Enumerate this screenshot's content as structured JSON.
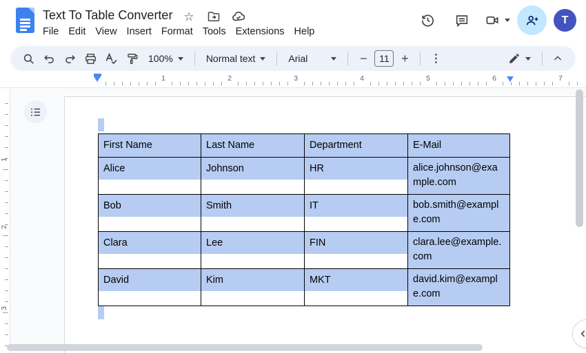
{
  "header": {
    "title": "Text To Table Converter",
    "menus": [
      "File",
      "Edit",
      "View",
      "Insert",
      "Format",
      "Tools",
      "Extensions",
      "Help"
    ],
    "avatar_initial": "T"
  },
  "icons": {
    "star": "☆",
    "kebab": "⋮",
    "minus": "−",
    "plus": "+"
  },
  "toolbar": {
    "zoom_value": "100%",
    "style_value": "Normal text",
    "font_value": "Arial",
    "font_size_value": "11"
  },
  "ruler": {
    "h_numbers": [
      "1",
      "2",
      "3",
      "4",
      "5",
      "6",
      "7"
    ],
    "v_numbers": [
      "1",
      "2",
      "3"
    ]
  },
  "table": {
    "headers": [
      "First Name",
      "Last Name",
      "Department",
      "E-Mail"
    ],
    "rows": [
      [
        "Alice",
        "Johnson",
        "HR",
        "alice.johnson@example.com"
      ],
      [
        "Bob",
        "Smith",
        "IT",
        "bob.smith@example.com"
      ],
      [
        "Clara",
        "Lee",
        "FIN",
        "clara.lee@example.com"
      ],
      [
        "David",
        "Kim",
        "MKT",
        "david.kim@example.com"
      ]
    ]
  },
  "colors": {
    "selection_blue": "#b7ccf2",
    "toolbar_bg": "#edf2fa",
    "share_bg": "#c2e7ff",
    "avatar_bg": "#4353c0",
    "docs_icon_blue": "#3b82f0",
    "canvas_bg": "#f9fbfd"
  }
}
